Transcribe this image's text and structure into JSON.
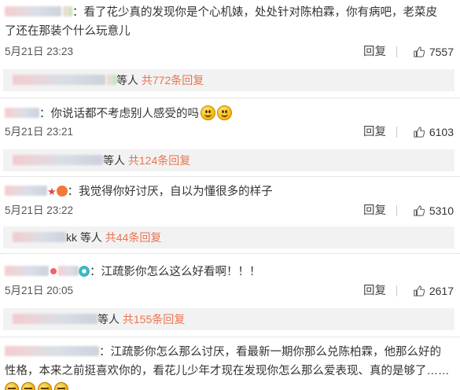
{
  "comments": [
    {
      "text_lines": [
        "：看了花少真的发现你是个心机婊，处处针对陈柏霖，你有病吧，老菜皮",
        "了还在那装个什么玩意儿"
      ],
      "time": "5月21日 23:23",
      "reply_label": "回复",
      "likes": "7557",
      "sub_prefix": "等人",
      "sub_count": "共772条回复"
    },
    {
      "text_lines": [
        "：你说话都不考虑别人感受的吗"
      ],
      "time": "5月21日 23:21",
      "reply_label": "回复",
      "likes": "6103",
      "sub_prefix": "等人",
      "sub_count": "共124条回复"
    },
    {
      "text_lines": [
        "：我觉得你好讨厌，自以为懂很多的样子"
      ],
      "time": "5月21日 23:22",
      "reply_label": "回复",
      "likes": "5310",
      "sub_prefix": "kk 等人",
      "sub_count": "共44条回复"
    },
    {
      "text_lines": [
        "：江疏影你怎么这么好看啊！！！"
      ],
      "time": "5月21日 20:05",
      "reply_label": "回复",
      "likes": "2617",
      "sub_prefix": "等人",
      "sub_count": "共155条回复"
    },
    {
      "text_lines": [
        "：江疏影你怎么那么讨厌，看最新一期你那么兑陈柏霖，他那么好的",
        "性格，本来之前挺喜欢你的，看花儿少年才现在发现你怎么那么爱表现、真的是够了……"
      ]
    }
  ],
  "colors": {
    "accent": "#eb7350",
    "sub_bg": "#f2f2f2"
  },
  "icons": [
    "thumb-up-icon",
    "smile-emoji-icon",
    "angry-emoji-icon",
    "avatar-badge-icon"
  ]
}
